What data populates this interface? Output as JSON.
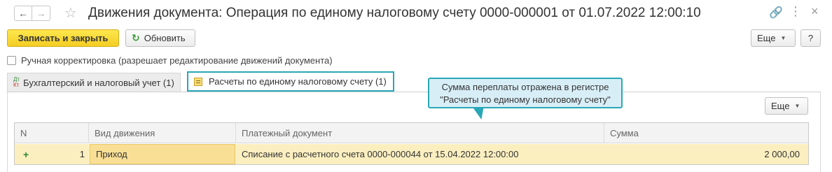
{
  "window": {
    "title": "Движения документа: Операция по единому налоговому счету 0000-000001 от 01.07.2022 12:00:10"
  },
  "icons": {
    "back": "arrow-left-icon",
    "forward": "arrow-right-icon",
    "favorite": "star-icon",
    "link": "link-icon",
    "more": "more-icon",
    "close": "close-icon"
  },
  "toolbar": {
    "save_close_label": "Записать и закрыть",
    "refresh_label": "Обновить",
    "more_label": "Еще",
    "help_label": "?"
  },
  "manual_correction": {
    "label": "Ручная корректировка (разрешает редактирование движений документа)",
    "checked": false
  },
  "tabs": [
    {
      "label": "Бухгалтерский и налоговый учет (1)",
      "icon_dt": "Дт",
      "icon_kt": "Кт"
    },
    {
      "label": "Расчеты по единому налоговому счету (1)"
    }
  ],
  "tooltip": {
    "line1": "Сумма переплаты отражена в регистре",
    "line2": "\"Расчеты по единому налоговому счету\""
  },
  "table": {
    "more_label": "Еще",
    "columns": [
      "N",
      "Вид движения",
      "Платежный документ",
      "Сумма"
    ],
    "rows": [
      {
        "marker": "+",
        "n": "1",
        "kind": "Приход",
        "doc": "Списание с расчетного счета 0000-000044 от 15.04.2022 12:00:00",
        "amount": "2 000,00"
      }
    ]
  },
  "colors": {
    "accent_teal": "#2aa7b7",
    "primary_yellow": "#f4cd23",
    "row_highlight": "#fbefc0"
  }
}
